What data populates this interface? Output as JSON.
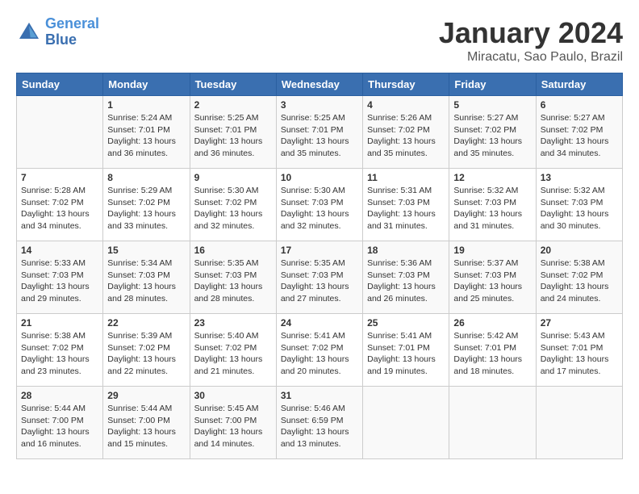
{
  "logo": {
    "line1": "General",
    "line2": "Blue"
  },
  "title": "January 2024",
  "subtitle": "Miracatu, Sao Paulo, Brazil",
  "days_of_week": [
    "Sunday",
    "Monday",
    "Tuesday",
    "Wednesday",
    "Thursday",
    "Friday",
    "Saturday"
  ],
  "weeks": [
    [
      {
        "num": "",
        "info": ""
      },
      {
        "num": "1",
        "info": "Sunrise: 5:24 AM\nSunset: 7:01 PM\nDaylight: 13 hours\nand 36 minutes."
      },
      {
        "num": "2",
        "info": "Sunrise: 5:25 AM\nSunset: 7:01 PM\nDaylight: 13 hours\nand 36 minutes."
      },
      {
        "num": "3",
        "info": "Sunrise: 5:25 AM\nSunset: 7:01 PM\nDaylight: 13 hours\nand 35 minutes."
      },
      {
        "num": "4",
        "info": "Sunrise: 5:26 AM\nSunset: 7:02 PM\nDaylight: 13 hours\nand 35 minutes."
      },
      {
        "num": "5",
        "info": "Sunrise: 5:27 AM\nSunset: 7:02 PM\nDaylight: 13 hours\nand 35 minutes."
      },
      {
        "num": "6",
        "info": "Sunrise: 5:27 AM\nSunset: 7:02 PM\nDaylight: 13 hours\nand 34 minutes."
      }
    ],
    [
      {
        "num": "7",
        "info": "Sunrise: 5:28 AM\nSunset: 7:02 PM\nDaylight: 13 hours\nand 34 minutes."
      },
      {
        "num": "8",
        "info": "Sunrise: 5:29 AM\nSunset: 7:02 PM\nDaylight: 13 hours\nand 33 minutes."
      },
      {
        "num": "9",
        "info": "Sunrise: 5:30 AM\nSunset: 7:02 PM\nDaylight: 13 hours\nand 32 minutes."
      },
      {
        "num": "10",
        "info": "Sunrise: 5:30 AM\nSunset: 7:03 PM\nDaylight: 13 hours\nand 32 minutes."
      },
      {
        "num": "11",
        "info": "Sunrise: 5:31 AM\nSunset: 7:03 PM\nDaylight: 13 hours\nand 31 minutes."
      },
      {
        "num": "12",
        "info": "Sunrise: 5:32 AM\nSunset: 7:03 PM\nDaylight: 13 hours\nand 31 minutes."
      },
      {
        "num": "13",
        "info": "Sunrise: 5:32 AM\nSunset: 7:03 PM\nDaylight: 13 hours\nand 30 minutes."
      }
    ],
    [
      {
        "num": "14",
        "info": "Sunrise: 5:33 AM\nSunset: 7:03 PM\nDaylight: 13 hours\nand 29 minutes."
      },
      {
        "num": "15",
        "info": "Sunrise: 5:34 AM\nSunset: 7:03 PM\nDaylight: 13 hours\nand 28 minutes."
      },
      {
        "num": "16",
        "info": "Sunrise: 5:35 AM\nSunset: 7:03 PM\nDaylight: 13 hours\nand 28 minutes."
      },
      {
        "num": "17",
        "info": "Sunrise: 5:35 AM\nSunset: 7:03 PM\nDaylight: 13 hours\nand 27 minutes."
      },
      {
        "num": "18",
        "info": "Sunrise: 5:36 AM\nSunset: 7:03 PM\nDaylight: 13 hours\nand 26 minutes."
      },
      {
        "num": "19",
        "info": "Sunrise: 5:37 AM\nSunset: 7:03 PM\nDaylight: 13 hours\nand 25 minutes."
      },
      {
        "num": "20",
        "info": "Sunrise: 5:38 AM\nSunset: 7:02 PM\nDaylight: 13 hours\nand 24 minutes."
      }
    ],
    [
      {
        "num": "21",
        "info": "Sunrise: 5:38 AM\nSunset: 7:02 PM\nDaylight: 13 hours\nand 23 minutes."
      },
      {
        "num": "22",
        "info": "Sunrise: 5:39 AM\nSunset: 7:02 PM\nDaylight: 13 hours\nand 22 minutes."
      },
      {
        "num": "23",
        "info": "Sunrise: 5:40 AM\nSunset: 7:02 PM\nDaylight: 13 hours\nand 21 minutes."
      },
      {
        "num": "24",
        "info": "Sunrise: 5:41 AM\nSunset: 7:02 PM\nDaylight: 13 hours\nand 20 minutes."
      },
      {
        "num": "25",
        "info": "Sunrise: 5:41 AM\nSunset: 7:01 PM\nDaylight: 13 hours\nand 19 minutes."
      },
      {
        "num": "26",
        "info": "Sunrise: 5:42 AM\nSunset: 7:01 PM\nDaylight: 13 hours\nand 18 minutes."
      },
      {
        "num": "27",
        "info": "Sunrise: 5:43 AM\nSunset: 7:01 PM\nDaylight: 13 hours\nand 17 minutes."
      }
    ],
    [
      {
        "num": "28",
        "info": "Sunrise: 5:44 AM\nSunset: 7:00 PM\nDaylight: 13 hours\nand 16 minutes."
      },
      {
        "num": "29",
        "info": "Sunrise: 5:44 AM\nSunset: 7:00 PM\nDaylight: 13 hours\nand 15 minutes."
      },
      {
        "num": "30",
        "info": "Sunrise: 5:45 AM\nSunset: 7:00 PM\nDaylight: 13 hours\nand 14 minutes."
      },
      {
        "num": "31",
        "info": "Sunrise: 5:46 AM\nSunset: 6:59 PM\nDaylight: 13 hours\nand 13 minutes."
      },
      {
        "num": "",
        "info": ""
      },
      {
        "num": "",
        "info": ""
      },
      {
        "num": "",
        "info": ""
      }
    ]
  ]
}
